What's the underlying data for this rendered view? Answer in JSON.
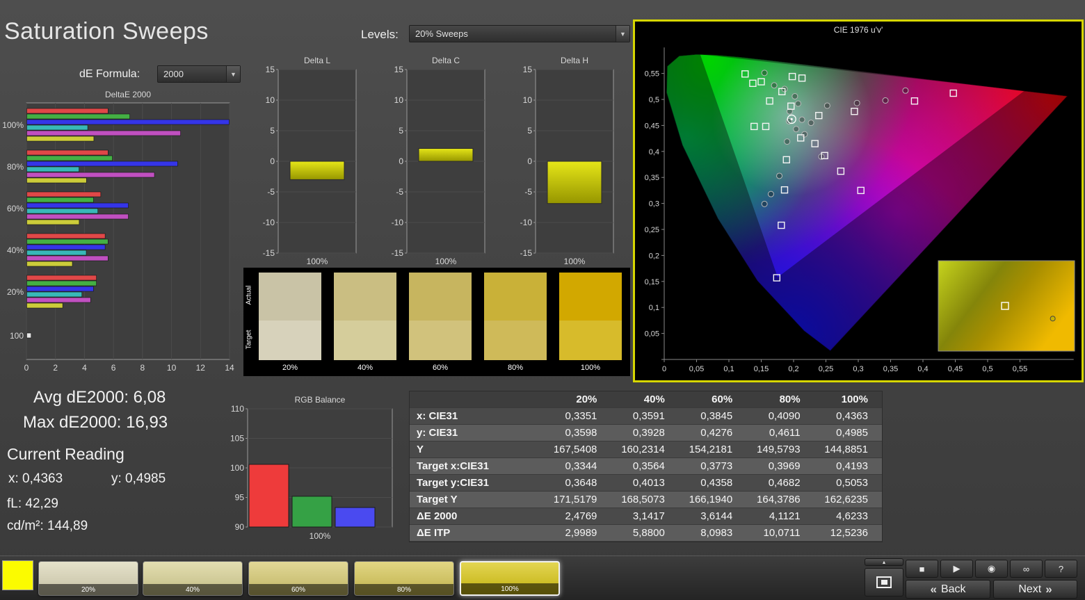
{
  "app": {
    "title": "Saturation Sweeps",
    "levels_label": "Levels:",
    "levels_value": "20% Sweeps",
    "de_formula_label": "dE Formula:",
    "de_formula_value": "2000",
    "accent_yellow": "#d6d600"
  },
  "readings": {
    "avg": "Avg dE2000: 6,08",
    "max": "Max dE2000: 16,93",
    "current_title": "Current Reading",
    "x": "x: 0,4363",
    "y": "y: 0,4985",
    "fl": "fL: 42,29",
    "cdm2": "cd/m²: 144,89"
  },
  "chart_data": [
    {
      "id": "deltae2000",
      "type": "bar",
      "orientation": "horizontal",
      "title": "DeltaE 2000",
      "xlim": [
        0,
        14
      ],
      "xticks": [
        0,
        2,
        4,
        6,
        8,
        10,
        12,
        14
      ],
      "categories": [
        "100%",
        "80%",
        "60%",
        "40%",
        "20%",
        "100"
      ],
      "series": [
        {
          "name": "red",
          "color": "#e04848",
          "values": [
            5.6,
            5.6,
            5.1,
            5.4,
            4.8,
            null
          ]
        },
        {
          "name": "green",
          "color": "#44b044",
          "values": [
            7.1,
            5.9,
            4.6,
            5.6,
            4.8,
            null
          ]
        },
        {
          "name": "blue",
          "color": "#3535e8",
          "values": [
            16.93,
            10.4,
            7.0,
            5.4,
            4.6,
            null
          ]
        },
        {
          "name": "cyan",
          "color": "#38b8b8",
          "values": [
            4.2,
            3.6,
            4.9,
            4.1,
            3.8,
            null
          ]
        },
        {
          "name": "magenta",
          "color": "#c050c0",
          "values": [
            10.6,
            8.8,
            7.0,
            5.6,
            4.4,
            null
          ]
        },
        {
          "name": "yellow",
          "color": "#cccc3a",
          "values": [
            4.6233,
            4.1121,
            3.6144,
            3.1417,
            2.4769,
            null
          ]
        },
        {
          "name": "white",
          "color": "#e8e8e8",
          "values": [
            null,
            null,
            null,
            null,
            null,
            0.3
          ]
        }
      ]
    },
    {
      "id": "delta_l",
      "type": "bar",
      "title": "Delta L",
      "ylim": [
        -15,
        15
      ],
      "yticks": [
        -15,
        -10,
        -5,
        0,
        5,
        10,
        15
      ],
      "categories": [
        "100%"
      ],
      "values": [
        -3.0
      ],
      "bar_color": "#e6e618",
      "bar_color_dark": "#969600"
    },
    {
      "id": "delta_c",
      "type": "bar",
      "title": "Delta C",
      "ylim": [
        -15,
        15
      ],
      "yticks": [
        -15,
        -10,
        -5,
        0,
        5,
        10,
        15
      ],
      "categories": [
        "100%"
      ],
      "values": [
        2.1
      ],
      "bar_color": "#e6e618",
      "bar_color_dark": "#969600"
    },
    {
      "id": "delta_h",
      "type": "bar",
      "title": "Delta H",
      "ylim": [
        -15,
        15
      ],
      "yticks": [
        -15,
        -10,
        -5,
        0,
        5,
        10,
        15
      ],
      "categories": [
        "100%"
      ],
      "values": [
        -6.9
      ],
      "bar_color": "#e6e618",
      "bar_color_dark": "#969600"
    },
    {
      "id": "rgb_balance",
      "type": "bar",
      "title": "RGB Balance",
      "ylim": [
        90,
        110
      ],
      "yticks": [
        90,
        95,
        100,
        105,
        110
      ],
      "categories": [
        "Red",
        "Green",
        "Blue"
      ],
      "values": [
        100.6,
        95.2,
        93.3
      ],
      "colors": [
        "#ee3b3b",
        "#35a145",
        "#4a4af0"
      ],
      "xlabel": "100%"
    },
    {
      "id": "cie_1976",
      "type": "scatter",
      "title": "CIE 1976 u'v'",
      "xlim": [
        0,
        0.63
      ],
      "ylim": [
        0,
        0.6
      ],
      "ticks": [
        0,
        0.05,
        0.1,
        0.15,
        0.2,
        0.25,
        0.3,
        0.35,
        0.4,
        0.45,
        0.5,
        0.55
      ],
      "tick_labels": [
        "0",
        "0,05",
        "0,1",
        "0,15",
        "0,2",
        "0,25",
        "0,3",
        "0,35",
        "0,4",
        "0,45",
        "0,5",
        "0,55"
      ],
      "gamut_triangle": [
        [
          0.0556,
          0.5868
        ],
        [
          0.5566,
          0.5165
        ],
        [
          0.1754,
          0.1579
        ]
      ],
      "white_point": [
        0.197,
        0.462
      ],
      "targets": [
        [
          0.125,
          0.549
        ],
        [
          0.137,
          0.531
        ],
        [
          0.15,
          0.534
        ],
        [
          0.163,
          0.497
        ],
        [
          0.198,
          0.544
        ],
        [
          0.213,
          0.541
        ],
        [
          0.182,
          0.515
        ],
        [
          0.447,
          0.512
        ],
        [
          0.387,
          0.497
        ],
        [
          0.294,
          0.477
        ],
        [
          0.239,
          0.469
        ],
        [
          0.139,
          0.448
        ],
        [
          0.157,
          0.448
        ],
        [
          0.196,
          0.487
        ],
        [
          0.211,
          0.426
        ],
        [
          0.233,
          0.415
        ],
        [
          0.189,
          0.384
        ],
        [
          0.248,
          0.392
        ],
        [
          0.273,
          0.362
        ],
        [
          0.186,
          0.326
        ],
        [
          0.304,
          0.325
        ],
        [
          0.181,
          0.258
        ],
        [
          0.174,
          0.157
        ]
      ],
      "measurements": [
        [
          0.155,
          0.551
        ],
        [
          0.17,
          0.527
        ],
        [
          0.186,
          0.52
        ],
        [
          0.202,
          0.506
        ],
        [
          0.207,
          0.492
        ],
        [
          0.194,
          0.477
        ],
        [
          0.373,
          0.517
        ],
        [
          0.342,
          0.498
        ],
        [
          0.298,
          0.493
        ],
        [
          0.252,
          0.488
        ],
        [
          0.193,
          0.458
        ],
        [
          0.204,
          0.443
        ],
        [
          0.217,
          0.433
        ],
        [
          0.19,
          0.419
        ],
        [
          0.243,
          0.39
        ],
        [
          0.178,
          0.353
        ],
        [
          0.165,
          0.318
        ],
        [
          0.155,
          0.299
        ],
        [
          0.213,
          0.461
        ],
        [
          0.227,
          0.455
        ]
      ],
      "inset": {
        "target": [
          0.49,
          0.5
        ],
        "measurement": [
          0.84,
          0.64
        ]
      }
    }
  ],
  "swatches": {
    "row_labels": [
      "Actual",
      "Target"
    ],
    "columns": [
      {
        "label": "20%",
        "actual": "#c9c3a6",
        "target": "#d7d2bb"
      },
      {
        "label": "40%",
        "actual": "#cabe82",
        "target": "#d5cd9b"
      },
      {
        "label": "60%",
        "actual": "#c7b55f",
        "target": "#d1c27c"
      },
      {
        "label": "80%",
        "actual": "#c9b138",
        "target": "#cfba59"
      },
      {
        "label": "100%",
        "actual": "#d2a800",
        "target": "#d7bb2b"
      }
    ]
  },
  "table": {
    "columns": [
      "20%",
      "40%",
      "60%",
      "80%",
      "100%"
    ],
    "rows": [
      {
        "label": "x: CIE31",
        "values": [
          "0,3351",
          "0,3591",
          "0,3845",
          "0,4090",
          "0,4363"
        ]
      },
      {
        "label": "y: CIE31",
        "values": [
          "0,3598",
          "0,3928",
          "0,4276",
          "0,4611",
          "0,4985"
        ]
      },
      {
        "label": "Y",
        "values": [
          "167,5408",
          "160,2314",
          "154,2181",
          "149,5793",
          "144,8851"
        ]
      },
      {
        "label": "Target x:CIE31",
        "values": [
          "0,3344",
          "0,3564",
          "0,3773",
          "0,3969",
          "0,4193"
        ]
      },
      {
        "label": "Target y:CIE31",
        "values": [
          "0,3648",
          "0,4013",
          "0,4358",
          "0,4682",
          "0,5053"
        ]
      },
      {
        "label": "Target Y",
        "values": [
          "171,5179",
          "168,5073",
          "166,1940",
          "164,3786",
          "162,6235"
        ]
      },
      {
        "label": "ΔE 2000",
        "values": [
          "2,4769",
          "3,1417",
          "3,6144",
          "4,1121",
          "4,6233"
        ]
      },
      {
        "label": "ΔE ITP",
        "values": [
          "2,9989",
          "5,8800",
          "8,0983",
          "10,0711",
          "12,5236"
        ]
      }
    ]
  },
  "bottom": {
    "selected_swatch_color": "#fbfb00",
    "patches": [
      {
        "label": "20%",
        "color": "#dbd6b6",
        "selected": false
      },
      {
        "label": "40%",
        "color": "#d8d193",
        "selected": false
      },
      {
        "label": "60%",
        "color": "#d6c96f",
        "selected": false
      },
      {
        "label": "80%",
        "color": "#d6c654",
        "selected": false
      },
      {
        "label": "100%",
        "color": "#d8c510",
        "selected": true
      }
    ],
    "controls": {
      "transport_buttons": [
        {
          "name": "stop-button",
          "glyph": "■"
        },
        {
          "name": "play-button",
          "glyph": "▶"
        },
        {
          "name": "record-button",
          "glyph": "◉"
        },
        {
          "name": "continuous-measure-button",
          "glyph": "∞"
        },
        {
          "name": "help-button",
          "glyph": "?"
        }
      ],
      "collapse_glyph": "▴",
      "back_chevron": "«",
      "back_label": "Back",
      "next_label": "Next",
      "next_chevron": "»"
    }
  }
}
